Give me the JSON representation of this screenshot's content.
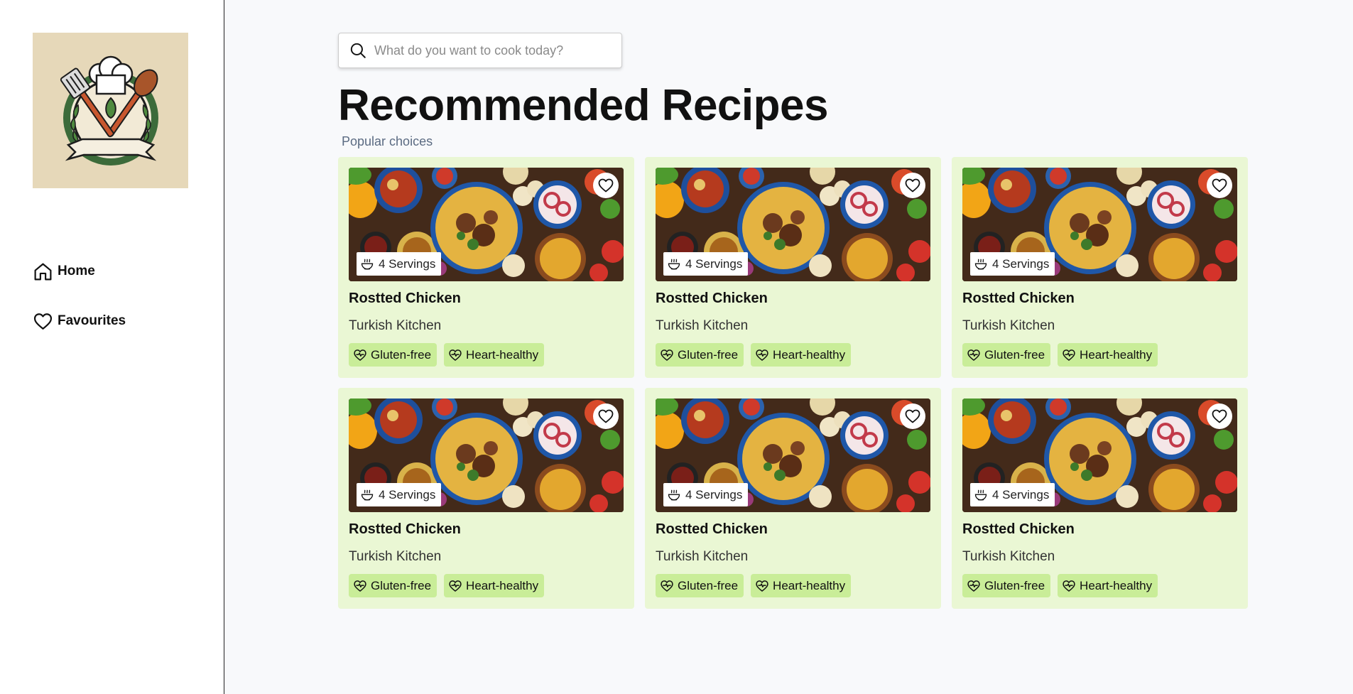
{
  "sidebar": {
    "logo_alt": "Chef hat cooking logo",
    "nav": [
      {
        "label": "Home",
        "icon": "home-icon"
      },
      {
        "label": "Favourites",
        "icon": "heart-icon"
      }
    ]
  },
  "search": {
    "placeholder": "What do you want to cook today?",
    "icon": "search-icon"
  },
  "main": {
    "title": "Recommended Recipes",
    "subtitle": "Popular choices"
  },
  "recipes": [
    {
      "title": "Rostted Chicken",
      "cuisine": "Turkish Kitchen",
      "servings": "4 Servings",
      "tags": [
        "Gluten-free",
        "Heart-healthy"
      ]
    },
    {
      "title": "Rostted Chicken",
      "cuisine": "Turkish Kitchen",
      "servings": "4 Servings",
      "tags": [
        "Gluten-free",
        "Heart-healthy"
      ]
    },
    {
      "title": "Rostted Chicken",
      "cuisine": "Turkish Kitchen",
      "servings": "4 Servings",
      "tags": [
        "Gluten-free",
        "Heart-healthy"
      ]
    },
    {
      "title": "Rostted Chicken",
      "cuisine": "Turkish Kitchen",
      "servings": "4 Servings",
      "tags": [
        "Gluten-free",
        "Heart-healthy"
      ]
    },
    {
      "title": "Rostted Chicken",
      "cuisine": "Turkish Kitchen",
      "servings": "4 Servings",
      "tags": [
        "Gluten-free",
        "Heart-healthy"
      ]
    },
    {
      "title": "Rostted Chicken",
      "cuisine": "Turkish Kitchen",
      "servings": "4 Servings",
      "tags": [
        "Gluten-free",
        "Heart-healthy"
      ]
    }
  ],
  "colors": {
    "card_bg": "#eaf7d4",
    "tag_bg": "#c9ed98",
    "page_bg": "#f8f9fb",
    "logo_bg": "#e6d8b9"
  }
}
